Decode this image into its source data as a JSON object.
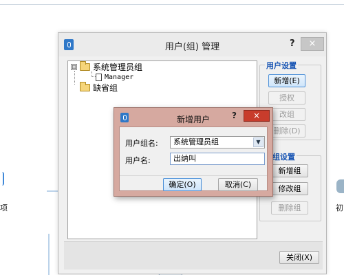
{
  "background": {
    "left_fragment_text": "项",
    "right_fragment_text": "初"
  },
  "main_dialog": {
    "title": "用户(组) 管理",
    "help_label": "?",
    "close_label": "×",
    "tree": {
      "items": [
        {
          "label": "系统管理员组",
          "expander": "⊟",
          "children": [
            {
              "label": "Manager"
            }
          ]
        },
        {
          "label": "缺省组"
        }
      ]
    },
    "user_settings": {
      "title": "用户设置",
      "buttons": [
        {
          "label": "新增(E)",
          "enabled": true
        },
        {
          "label": "授权",
          "enabled": false
        },
        {
          "label": "改组",
          "enabled": false
        },
        {
          "label": "删除(D)",
          "enabled": false
        }
      ]
    },
    "group_settings": {
      "title": "用户组设置",
      "buttons": [
        {
          "label": "新增组",
          "enabled": true
        },
        {
          "label": "修改组",
          "enabled": true
        },
        {
          "label": "删除组",
          "enabled": false
        }
      ]
    },
    "footer": {
      "close_button": "关闭(X)"
    }
  },
  "modal": {
    "title": "新增用户",
    "help_label": "?",
    "close_label": "×",
    "group_label": "用户组名:",
    "group_value": "系统管理员组",
    "username_label": "用户名:",
    "username_value": "出纳叫",
    "ok_button": "确定(O)",
    "cancel_button": "取消(C)"
  },
  "colors": {
    "accent": "#2f78c8",
    "group_title": "#1a56b4",
    "modal_frame": "#d6a9a0",
    "modal_close": "#c83c2c"
  }
}
